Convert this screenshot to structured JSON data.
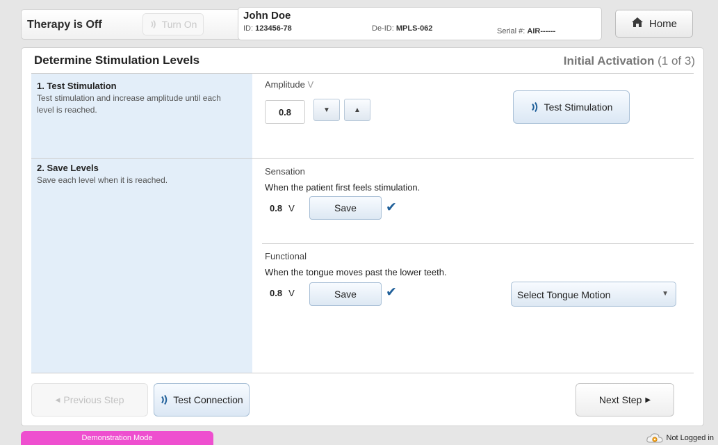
{
  "therapy": {
    "status": "Therapy is Off",
    "turn_on_label": "Turn On"
  },
  "patient": {
    "name": "John Doe",
    "id_label": "ID:",
    "id_value": "123456-78",
    "deid_label": "De-ID:",
    "deid_value": "MPLS-062",
    "serial_label": "Serial #:",
    "serial_value": "AIR------"
  },
  "header": {
    "home_label": "Home"
  },
  "page": {
    "title": "Determine Stimulation Levels",
    "activation_label": "Initial Activation",
    "activation_progress": "(1 of 3)"
  },
  "step1": {
    "title": "1. Test Stimulation",
    "description": "Test stimulation and increase amplitude until each level is reached.",
    "amplitude_label": "Amplitude",
    "amplitude_unit": "V",
    "amplitude_value": "0.8",
    "down_glyph": "▼",
    "up_glyph": "▲",
    "test_button": "Test Stimulation"
  },
  "step2": {
    "title": "2. Save Levels",
    "description": "Save each level when it is reached.",
    "sensation": {
      "label": "Sensation",
      "description": "When the patient first feels stimulation.",
      "value": "0.8",
      "unit": "V",
      "save_label": "Save",
      "check": "✔"
    },
    "functional": {
      "label": "Functional",
      "description": "When the tongue moves past the lower teeth.",
      "value": "0.8",
      "unit": "V",
      "save_label": "Save",
      "check": "✔",
      "select_label": "Select Tongue Motion",
      "select_caret": "▼"
    }
  },
  "footer": {
    "previous_label": "Previous Step",
    "connection_label": "Test Connection",
    "next_label": "Next Step",
    "prev_arrow": "◀",
    "next_arrow": "▶"
  },
  "status_bar": {
    "mode": "Demonstration Mode",
    "login": "Not Logged in"
  },
  "colors": {
    "accent_blue": "#1f5f99",
    "demo_pink": "#ee4fcf",
    "panel_blue": "#e3eef9"
  },
  "icons": [
    "signal-wave-icon",
    "home-icon",
    "checkmark-icon",
    "cloud-icon"
  ]
}
